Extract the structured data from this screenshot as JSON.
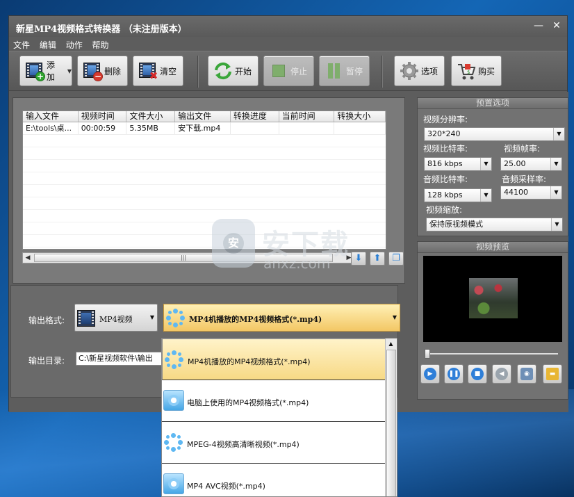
{
  "app": {
    "title": "新星MP4视频格式转换器 （未注册版本）",
    "min_btn": "—",
    "close_btn": "✕"
  },
  "menu": [
    "文件",
    "编辑",
    "动作",
    "帮助"
  ],
  "toolbar": {
    "add": "添加",
    "delete": "删除",
    "clear": "清空",
    "start": "开始",
    "stop": "停止",
    "pause": "暂停",
    "options": "选项",
    "buy": "购买"
  },
  "table": {
    "columns": [
      "输入文件",
      "视频时间",
      "文件大小",
      "输出文件",
      "转换进度",
      "当前时间",
      "转换大小"
    ],
    "rows": [
      [
        "E:\\tools\\桌...",
        "00:00:59",
        "5.35MB",
        "安下载.mp4",
        "",
        "",
        ""
      ]
    ]
  },
  "hscroll_grip": "|||",
  "output": {
    "format_label": "输出格式:",
    "format_category": "MP4视频",
    "format_selected": "MP4机播放的MP4视频格式(*.mp4)",
    "dir_label": "输出目录:",
    "dir_value": "C:\\新星视频软件\\输出"
  },
  "dropdown": {
    "items": [
      "MP4机播放的MP4视频格式(*.mp4)",
      "电脑上使用的MP4视频格式(*.mp4)",
      "MPEG-4视频高清晰视频(*.mp4)",
      "MP4 AVC视频(*.mp4)"
    ]
  },
  "preset": {
    "header": "预置选项",
    "resolution_label": "视频分辨率:",
    "resolution": "320*240",
    "vbitrate_label": "视频比特率:",
    "vbitrate": "816 kbps",
    "framerate_label": "视频帧率:",
    "framerate": "25.00",
    "abitrate_label": "音频比特率:",
    "abitrate": "128 kbps",
    "samplerate_label": "音频采样率:",
    "samplerate": "44100",
    "scale_label": "视频缩放:",
    "scale": "保持原视频模式"
  },
  "preview": {
    "header": "视频预览"
  },
  "watermark": {
    "text": "安下载",
    "url": "anxz.com"
  },
  "colors": {
    "window_bg": "#5d5d5d",
    "selected_combo": "#f3c765",
    "accent_blue": "#2f7fd8"
  }
}
